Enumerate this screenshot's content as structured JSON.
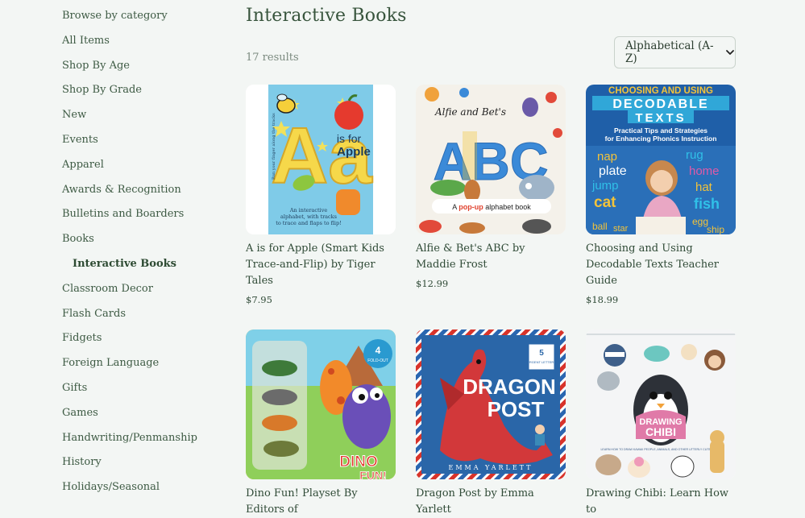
{
  "sidebar": {
    "items": [
      {
        "label": "Browse by category"
      },
      {
        "label": "All Items"
      },
      {
        "label": "Shop By Age"
      },
      {
        "label": "Shop By Grade"
      },
      {
        "label": "New"
      },
      {
        "label": "Events"
      },
      {
        "label": "Apparel"
      },
      {
        "label": "Awards & Recognition"
      },
      {
        "label": "Bulletins and Boarders"
      },
      {
        "label": "Books"
      },
      {
        "label": "Interactive Books"
      },
      {
        "label": "Classroom Decor"
      },
      {
        "label": "Flash Cards"
      },
      {
        "label": "Fidgets"
      },
      {
        "label": "Foreign Language"
      },
      {
        "label": "Gifts"
      },
      {
        "label": "Games"
      },
      {
        "label": "Handwriting/Penmanship"
      },
      {
        "label": "History"
      },
      {
        "label": "Holidays/Seasonal"
      }
    ]
  },
  "main": {
    "title": "Interactive Books",
    "results": "17 results",
    "sort_label": "Alphabetical (A-Z)"
  },
  "products": [
    {
      "title": "A is for Apple (Smart Kids Trace-and-Flip) by Tiger Tales",
      "price": "$7.95",
      "cover": {
        "big": "Aa",
        "line1": "is for",
        "line2": "Apple",
        "blurb1": "An interactive",
        "blurb2": "alphabet, with tracks",
        "blurb3": "to trace and flaps to flip!",
        "side": "Run your finger along the tracks"
      }
    },
    {
      "title": "Alfie & Bet's ABC by Maddie Frost",
      "price": "$12.99",
      "cover": {
        "top": "Alfie and Bet's",
        "big": "ABC",
        "tagline_a": "A ",
        "tagline_b": "pop-up",
        "tagline_c": " alphabet book"
      }
    },
    {
      "title": "Choosing and Using Decodable Texts Teacher Guide",
      "price": "$18.99",
      "cover": {
        "top": "CHOOSING AND USING",
        "big1": "DECODABLE",
        "big2": "TEXTS",
        "sub1": "Practical Tips and Strategies",
        "sub2": "for Enhancing Phonics Instruction",
        "words": [
          "nap",
          "rug",
          "plate",
          "home",
          "jump",
          "hat",
          "cat",
          "fish",
          "ball",
          "star",
          "egg",
          "ship"
        ]
      }
    },
    {
      "title": "Dino Fun! Playset By Editors of",
      "price": "",
      "cover": {
        "badge1": "4",
        "badge2": "FOLD-OUT",
        "big": "DINO",
        "big2": "FUN!"
      }
    },
    {
      "title": "Dragon Post by Emma Yarlett",
      "price": "",
      "cover": {
        "big1": "DRAGON",
        "big2": "POST",
        "author": "EMMA YARLETT",
        "stamp1": "5",
        "stamp2": "URGENT LETTERS"
      }
    },
    {
      "title": "Drawing Chibi: Learn How to",
      "price": "",
      "cover": {
        "big1": "DRAWING",
        "big2": "CHIBI",
        "sub": "LEARN HOW TO DRAW KAWAII PEOPLE, ANIMALS, AND OTHER UTTERLY CUTE STUFF"
      }
    }
  ],
  "colors": {
    "background": "#f3f6f4",
    "text": "#2f4a36",
    "muted": "#7b8a7f"
  }
}
